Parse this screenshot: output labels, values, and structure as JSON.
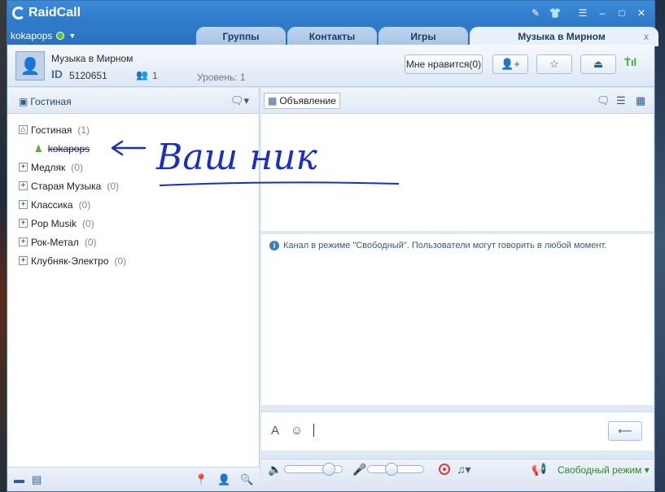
{
  "app": {
    "title": "RaidCall"
  },
  "window_buttons": [
    "edit-icon",
    "shirt-icon",
    "menu-icon",
    "minimize-icon",
    "maximize-icon",
    "close-icon"
  ],
  "user": {
    "name": "kokapops"
  },
  "tabs": [
    {
      "label": "Группы"
    },
    {
      "label": "Контакты"
    },
    {
      "label": "Игры"
    },
    {
      "label": "Музыка в Мирном",
      "close": "x"
    }
  ],
  "room": {
    "name": "Музыка в Мирном",
    "id_label": "ID",
    "id": "5120651",
    "members": "1",
    "level": "Уровень: 1",
    "like_button": "Мне нравится(0)"
  },
  "left_panel": {
    "title": "Гостиная",
    "channels": [
      {
        "name": "Гостиная",
        "count": "(1)",
        "icon": "home-icon",
        "users": [
          {
            "name": "kokapops"
          }
        ]
      },
      {
        "name": "Медляк",
        "count": "(0)"
      },
      {
        "name": "Старая Музыка",
        "count": "(0)"
      },
      {
        "name": "Классика",
        "count": "(0)"
      },
      {
        "name": "Pop Musik",
        "count": "(0)"
      },
      {
        "name": "Рок-Метал",
        "count": "(0)"
      },
      {
        "name": "Клубняк-Электро",
        "count": "(0)"
      }
    ]
  },
  "right_panel": {
    "announcement_button": "Объявление",
    "notice": "Канал в режиме \"Свободный\". Пользователи могут говорить в любой момент."
  },
  "bottom_bar": {
    "speaker_volume": 0.85,
    "mic_volume": 0.4,
    "mode": "Свободный режим"
  },
  "annotation": {
    "handwritten": "Ваш ник"
  },
  "colors": {
    "accent": "#2d78c8",
    "ink": "#1a2fbf",
    "mode_green": "#2d8a2a"
  }
}
